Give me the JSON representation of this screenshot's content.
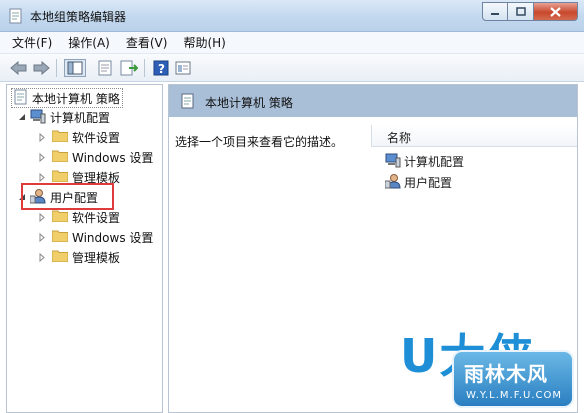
{
  "window": {
    "title": "本地组策略编辑器"
  },
  "menu": [
    "文件(F)",
    "操作(A)",
    "查看(V)",
    "帮助(H)"
  ],
  "tree": {
    "root": "本地计算机 策略",
    "computer_config": "计算机配置",
    "computer_children": [
      "软件设置",
      "Windows 设置",
      "管理模板"
    ],
    "user_config": "用户配置",
    "user_children": [
      "软件设置",
      "Windows 设置",
      "管理模板"
    ]
  },
  "right": {
    "header": "本地计算机 策略",
    "description": "选择一个项目来查看它的描述。",
    "column_name": "名称",
    "items": [
      "计算机配置",
      "用户配置"
    ]
  },
  "watermark": {
    "logo": "U大侠",
    "site": "雨林木风",
    "url": "W.Y.L.M.F.U.COM"
  },
  "colors": {
    "header_band": "#a9bfd8",
    "highlight": "#e03b3b",
    "folder": "#f0cf6a"
  }
}
